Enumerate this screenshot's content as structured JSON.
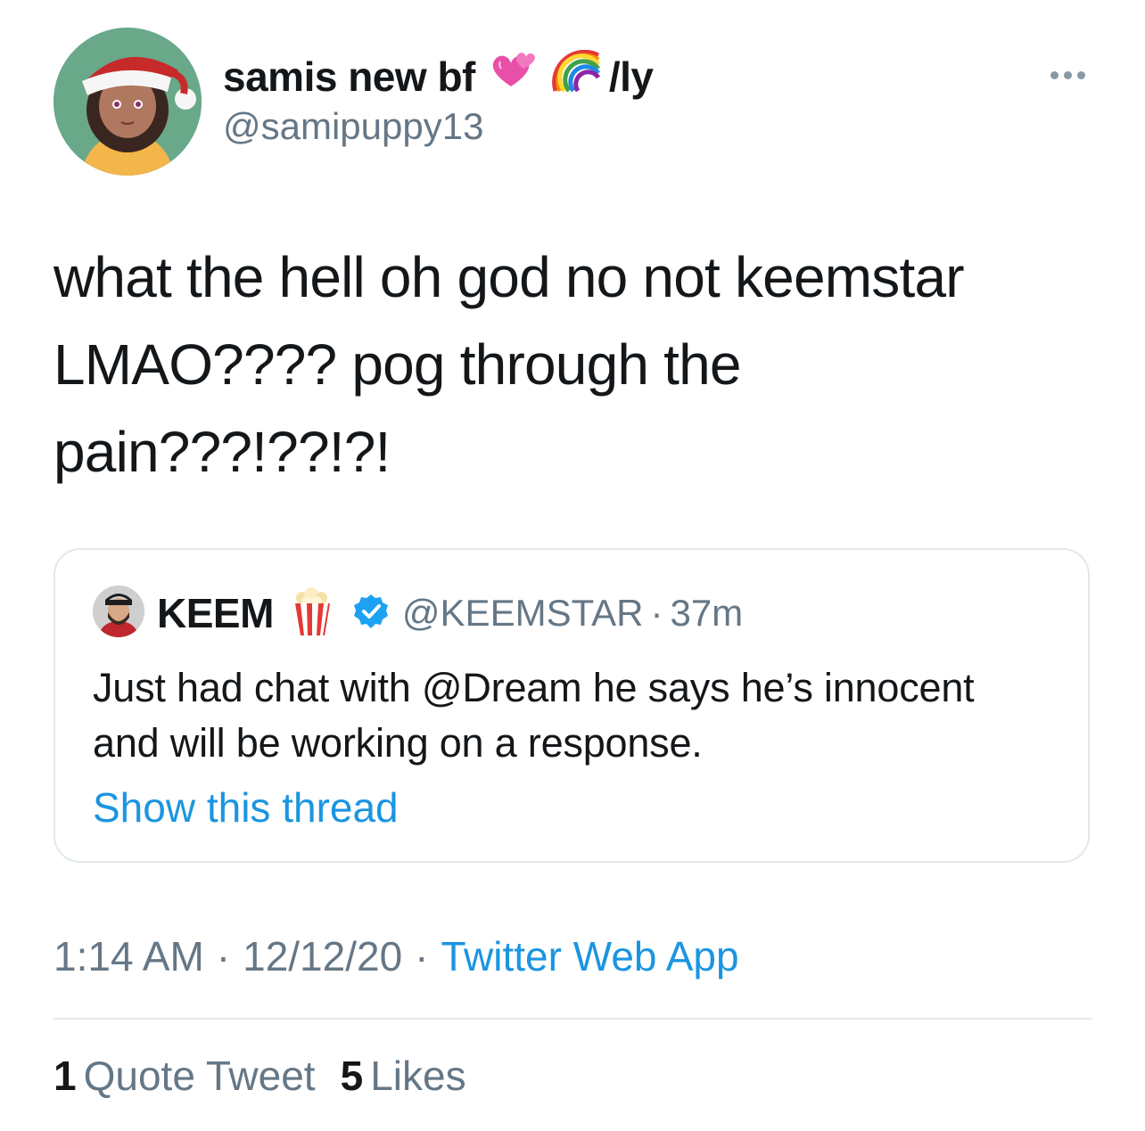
{
  "author": {
    "display_name": "samis new bf",
    "name_suffix": "/ly",
    "handle": "@samipuppy13",
    "name_emojis": [
      "two-hearts-icon",
      "rainbow-icon"
    ]
  },
  "tweet": {
    "lines": [
      "what the hell oh god no not keemstar",
      "LMAO???? pog through the",
      "pain???!??!?!"
    ],
    "timestamp": "1:14 AM",
    "date": "12/12/20",
    "separator": "·",
    "source": "Twitter Web App"
  },
  "quoted_tweet": {
    "display_name": "KEEM",
    "name_emoji": "popcorn-icon",
    "verified": true,
    "handle": "@KEEMSTAR",
    "separator": "·",
    "time_ago": "37m",
    "lines": [
      "Just had chat with @Dream he says he’s innocent",
      "and will be working on a response."
    ],
    "thread_link": "Show this thread"
  },
  "stats": {
    "quote_count": "1",
    "quote_label": "Quote Tweet",
    "like_count": "5",
    "like_label": "Likes"
  },
  "colors": {
    "link": "#1b95e0",
    "secondary_text": "#657786",
    "border": "#e1e8ed"
  }
}
